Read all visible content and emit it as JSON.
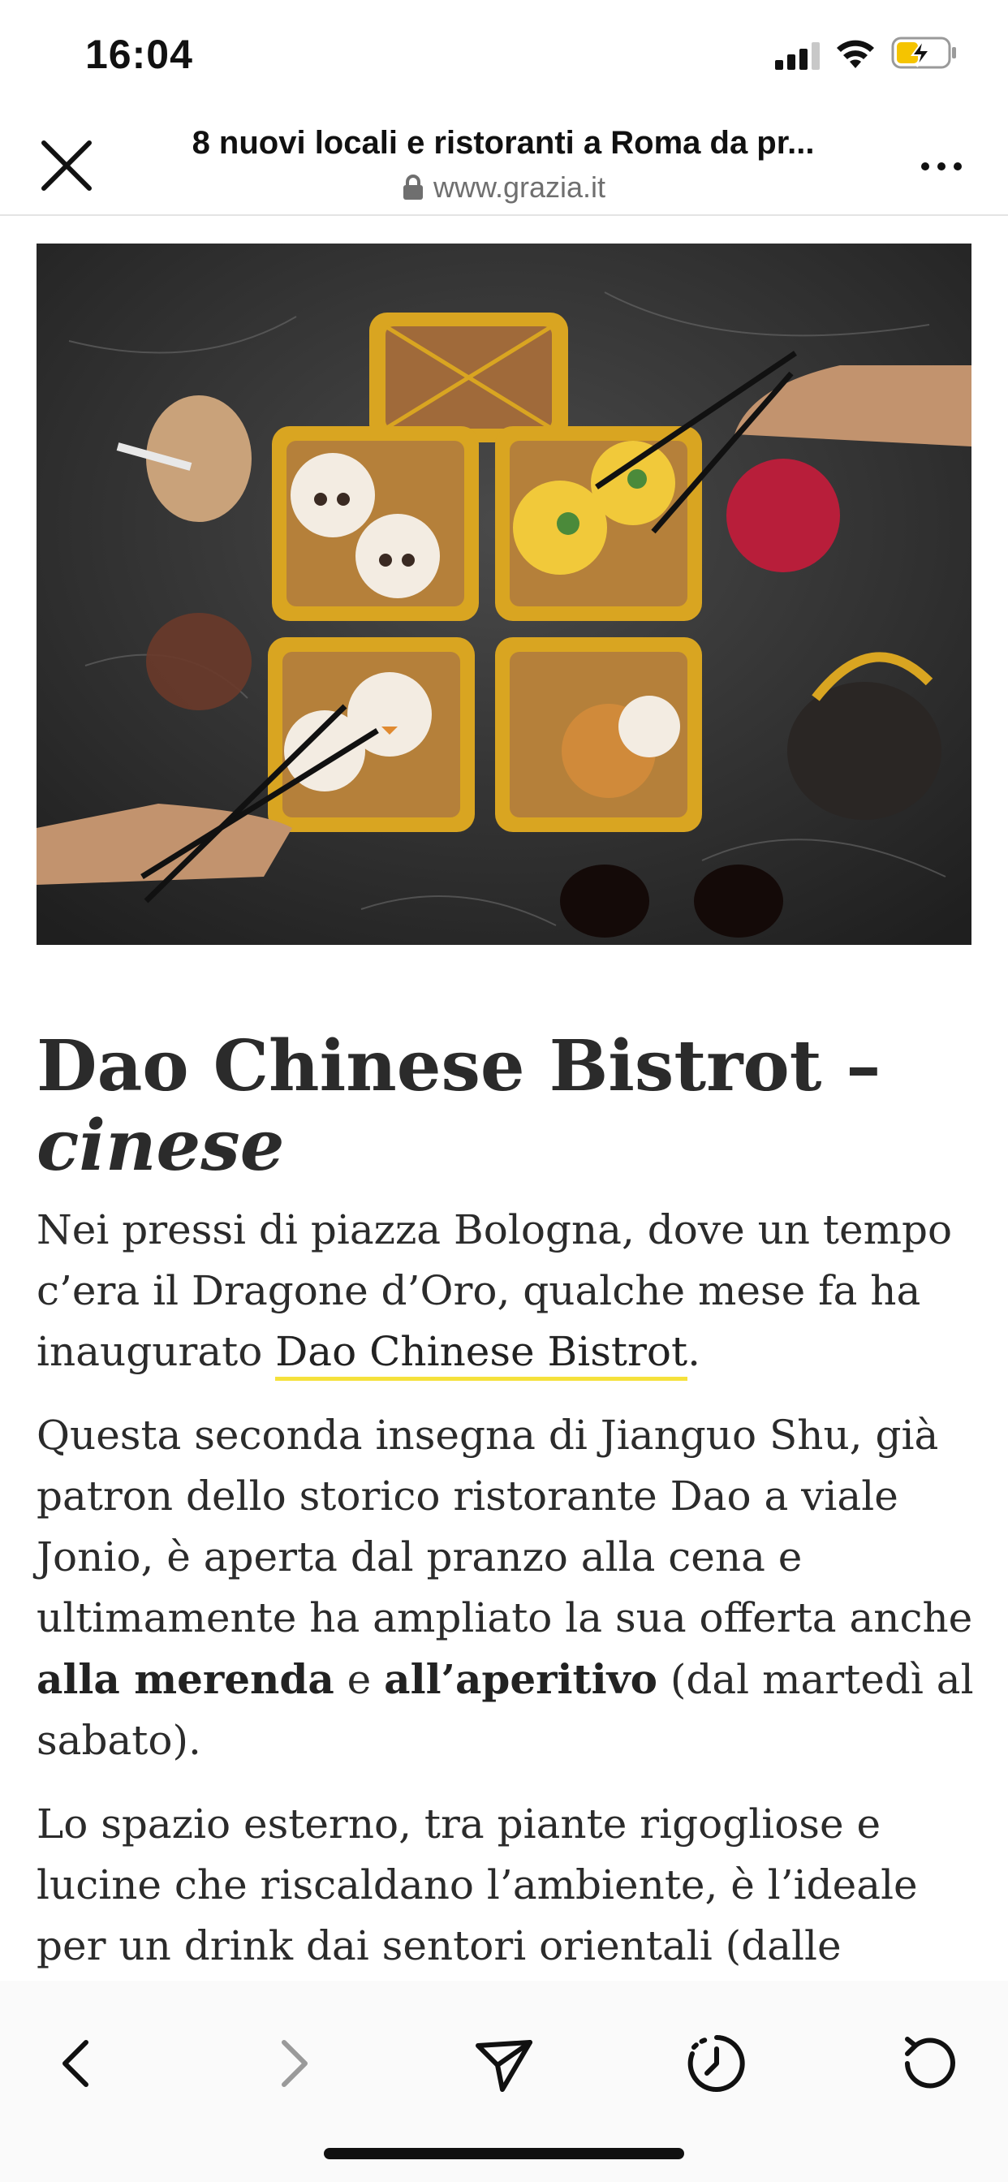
{
  "status_bar": {
    "time": "16:04"
  },
  "browser": {
    "title": "8 nuovi locali e ristoranti a Roma da pr...",
    "url": "www.grazia.it"
  },
  "article": {
    "heading_main": "Dao Chinese Bistrot –",
    "heading_sub": "cinese",
    "p1_a": "Nei pressi di piazza Bologna, dove un tempo c’era il Dragone d’Oro, qualche mese fa ha inaugurato ",
    "p1_link": "Dao Chinese Bistrot",
    "p1_b": ".",
    "p2_a": "Questa seconda insegna di Jianguo Shu, già patron dello storico ristorante Dao a viale Jonio, è aperta dal pranzo alla cena e ultimamente ha ampliato la sua offerta anche ",
    "p2_bold1": "alla merenda",
    "p2_b": " e ",
    "p2_bold2": "all’aperitivo",
    "p2_c": " (dal martedì al sabato).",
    "p3": "Lo spazio esterno, tra piante rigogliose e lucine che riscaldano l’ambiente, è l’ideale per un drink dai sentori orientali (dalle"
  },
  "icons": {
    "close": "close-icon",
    "more": "more-dots-icon",
    "lock": "lock-icon",
    "back": "chevron-left-icon",
    "forward": "chevron-right-icon",
    "share": "send-icon",
    "history": "clock-history-icon",
    "reload": "reload-icon"
  },
  "colors": {
    "link_underline": "#f5e13b",
    "battery_fill": "#f5c400",
    "disabled": "#9a9a9a"
  }
}
